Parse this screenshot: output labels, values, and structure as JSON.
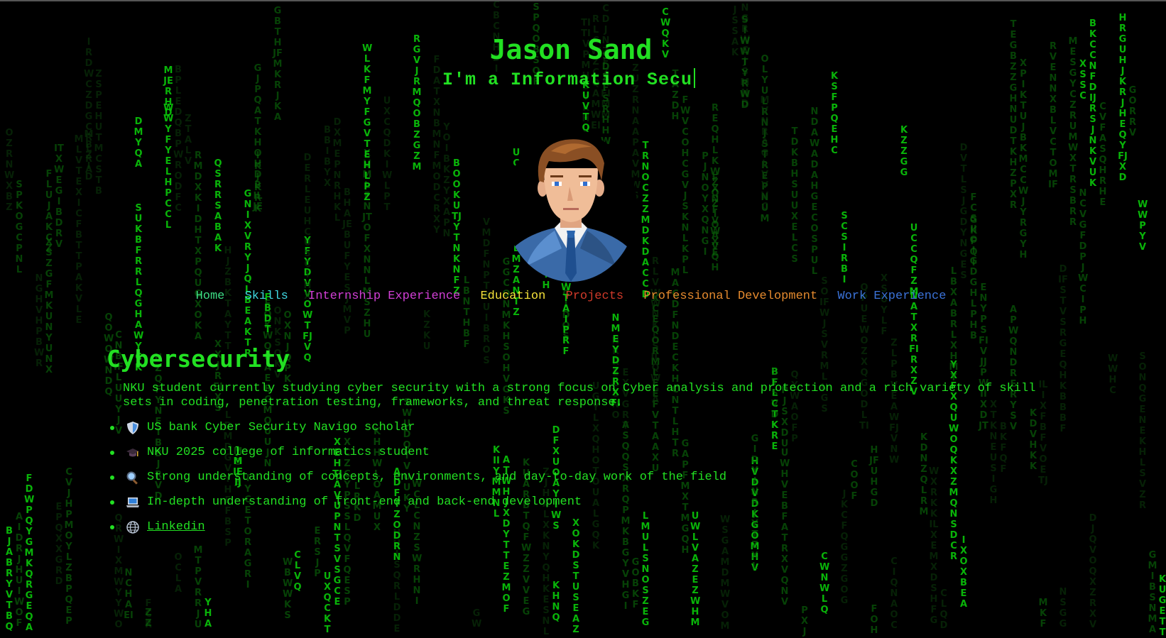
{
  "header": {
    "name": "Jason Sand",
    "typed_tagline": "I'm a Information Secu"
  },
  "nav": {
    "items": [
      {
        "label": "Home",
        "color": "#3ddc84"
      },
      {
        "label": "Skills",
        "color": "#3fd6e0"
      },
      {
        "label": "Internship Experience",
        "color": "#d23fd6"
      },
      {
        "label": "Education",
        "color": "#f5e23a"
      },
      {
        "label": "Projects",
        "color": "#d23a2a"
      },
      {
        "label": "Professional Development",
        "color": "#e58a2e"
      },
      {
        "label": "Work Experience",
        "color": "#3b73d9"
      }
    ]
  },
  "main": {
    "heading": "Cybersecurity",
    "intro": "NKU student currently studying cyber security with a strong focus on Cyber analysis and protection and a rich variety of skill sets in coding, penetration testing, frameworks, and threat response.",
    "features": [
      {
        "icon": "shield-icon",
        "text": "US bank Cyber Security Navigo scholar"
      },
      {
        "icon": "graduation-cap-icon",
        "text": "NKU 2025 college of informatics student"
      },
      {
        "icon": "magnifier-icon",
        "text": "Strong understanding of concepts, environments, and day-to-day work of the field"
      },
      {
        "icon": "laptop-icon",
        "text": "In-depth understanding of front-end and back-end development"
      },
      {
        "icon": "globe-icon",
        "text": "Linkedin",
        "is_link": true
      }
    ]
  },
  "theme": {
    "accent_green": "#22e022",
    "background": "#000000"
  }
}
